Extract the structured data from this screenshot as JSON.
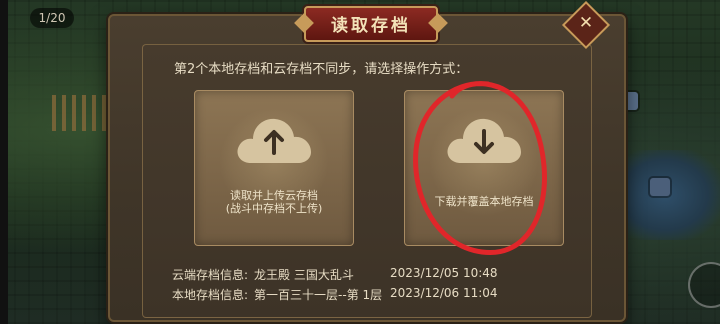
{
  "hud": {
    "level_counter": "1/20"
  },
  "dialog": {
    "title": "读取存档",
    "close_glyph": "✕",
    "prompt": "第2个本地存档和云存档不同步，请选择操作方式：",
    "options": [
      {
        "label_line1": "读取并上传云存档",
        "label_line2": "(战斗中存档不上传)",
        "icon": "cloud-upload-icon"
      },
      {
        "label_line1": "下载并覆盖本地存档",
        "label_line2": "",
        "icon": "cloud-download-icon"
      }
    ],
    "cloud_info": {
      "label": "云端存档信息:",
      "value": "龙王殿 三国大乱斗",
      "time": "2023/12/05 10:48"
    },
    "local_info": {
      "label": "本地存档信息:",
      "value": "第一百三十一层--第 1层",
      "time": "2023/12/06 11:04"
    }
  },
  "colors": {
    "title_plate": "#8c2a22",
    "annotation_circle": "#e0262a",
    "panel": "#3f3528"
  }
}
